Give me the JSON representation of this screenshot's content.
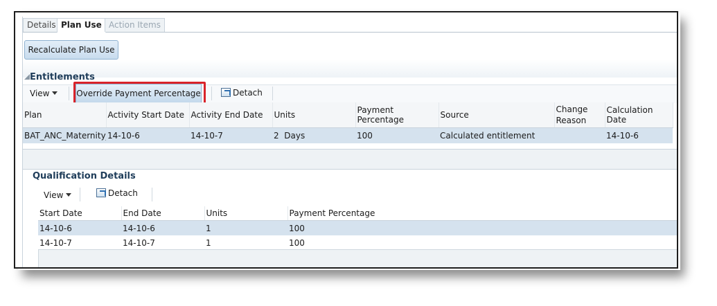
{
  "tabs": [
    {
      "label": "Details",
      "state": "normal"
    },
    {
      "label": "Plan Use",
      "state": "active"
    },
    {
      "label": "Action Items",
      "state": "disabled"
    }
  ],
  "recalc_button": "Recalculate Plan Use",
  "entitlements": {
    "title": "Entitlements",
    "toolbar": {
      "view": "View",
      "override": "Override Payment Percentage",
      "detach": "Detach"
    },
    "columns": [
      "Plan",
      "Activity Start Date",
      "Activity End Date",
      "Units",
      "Payment Percentage",
      "Source",
      "Change Reason",
      "Calculation Date"
    ],
    "rows": [
      [
        "BAT_ANC_Maternity_",
        "14-10-6",
        "14-10-7",
        "2  Days",
        "100",
        "Calculated entitlement",
        "",
        "14-10-6"
      ]
    ]
  },
  "qualification": {
    "title": "Qualification Details",
    "toolbar": {
      "view": "View",
      "detach": "Detach"
    },
    "columns": [
      "Start Date",
      "End Date",
      "Units",
      "Payment Percentage"
    ],
    "rows": [
      [
        "14-10-6",
        "14-10-6",
        "1",
        "100"
      ],
      [
        "14-10-7",
        "14-10-7",
        "1",
        "100"
      ]
    ]
  },
  "colors": {
    "highlight": "#d9232a",
    "selected_row": "#d5e2ee",
    "button": "#c8dcee"
  }
}
